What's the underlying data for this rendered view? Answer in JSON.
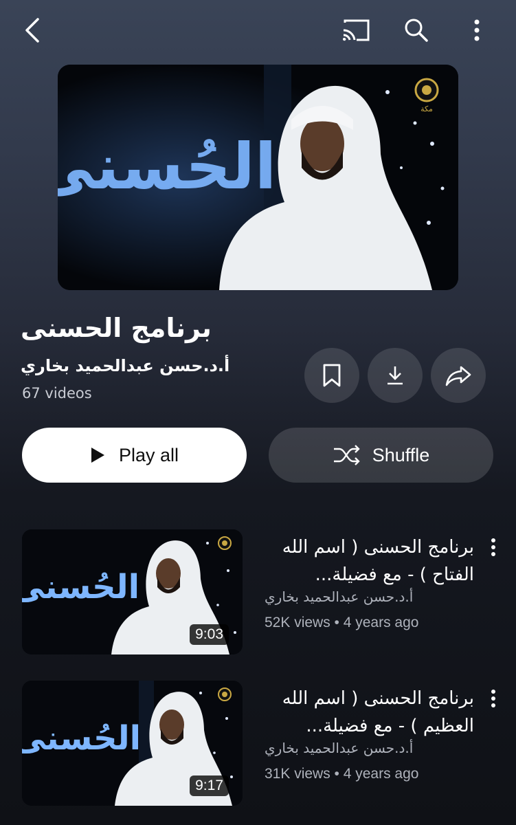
{
  "header": {
    "icons": [
      "back-icon",
      "cast-icon",
      "search-icon",
      "more-vertical-icon"
    ]
  },
  "playlist": {
    "thumb_text": "الحُسنى",
    "title": "برنامج الحسنى",
    "channel": "أ.د.حسن عبدالحميد بخاري",
    "count": "67 videos"
  },
  "actions": {
    "play_all": "Play all",
    "shuffle": "Shuffle"
  },
  "videos": [
    {
      "title": "برنامج الحسنى ( اسم الله الفتاح ) -  مع فضيلة...",
      "channel": "أ.د.حسن عبدالحميد بخاري",
      "meta": "52K views • 4 years ago",
      "duration": "9:03",
      "thumb_text": "الحُسنى"
    },
    {
      "title": "برنامج الحسنى ( اسم الله العظيم ) - مع فضيلة...",
      "channel": "أ.د.حسن عبدالحميد بخاري",
      "meta": "31K views • 4 years ago",
      "duration": "9:17",
      "thumb_text": "الحُسنى"
    }
  ],
  "colors": {
    "accent_white": "#ffffff",
    "secondary_text": "#aeb2bb",
    "button_dark": "#3a3d46"
  }
}
